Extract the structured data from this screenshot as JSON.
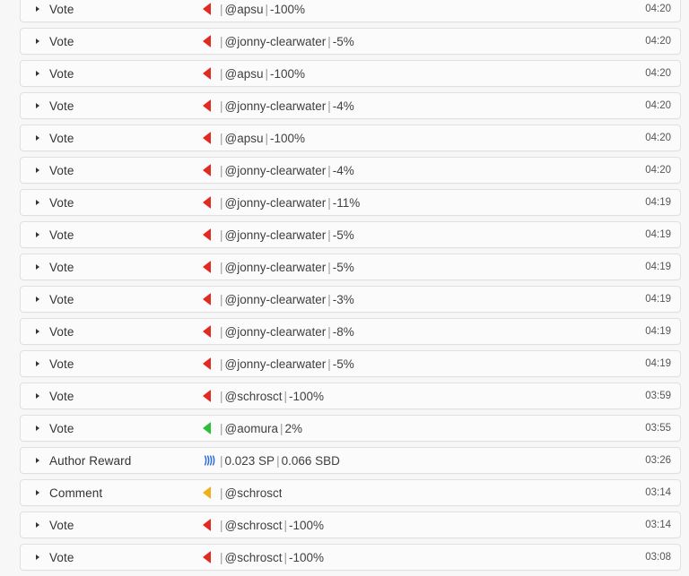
{
  "icons": {
    "expander": "chevron-right-icon",
    "downvote": "downvote-triangle-icon",
    "upvote": "upvote-triangle-icon",
    "comment": "comment-triangle-icon",
    "steem": "steem-logo-icon"
  },
  "colors": {
    "page_background": "#f7f7f7",
    "row_background": "#fbfbfb",
    "row_border": "#e0e0e0",
    "downvote_red": "#e02a22",
    "upvote_green": "#2cc039",
    "comment_yellow": "#efb01c",
    "steem_blue": "#2d6cdf",
    "label_text": "#333333",
    "detail_text": "#3f3f3f",
    "time_text": "#555555",
    "separator": "#9a9a9a"
  },
  "separator": "|",
  "rows": [
    {
      "op": "Vote",
      "icon": "downvote",
      "account": "@apsu",
      "value": "-100%",
      "time": "04:20"
    },
    {
      "op": "Vote",
      "icon": "downvote",
      "account": "@jonny-clearwater",
      "value": "-5%",
      "time": "04:20"
    },
    {
      "op": "Vote",
      "icon": "downvote",
      "account": "@apsu",
      "value": "-100%",
      "time": "04:20"
    },
    {
      "op": "Vote",
      "icon": "downvote",
      "account": "@jonny-clearwater",
      "value": "-4%",
      "time": "04:20"
    },
    {
      "op": "Vote",
      "icon": "downvote",
      "account": "@apsu",
      "value": "-100%",
      "time": "04:20"
    },
    {
      "op": "Vote",
      "icon": "downvote",
      "account": "@jonny-clearwater",
      "value": "-4%",
      "time": "04:20"
    },
    {
      "op": "Vote",
      "icon": "downvote",
      "account": "@jonny-clearwater",
      "value": "-11%",
      "time": "04:19"
    },
    {
      "op": "Vote",
      "icon": "downvote",
      "account": "@jonny-clearwater",
      "value": "-5%",
      "time": "04:19"
    },
    {
      "op": "Vote",
      "icon": "downvote",
      "account": "@jonny-clearwater",
      "value": "-5%",
      "time": "04:19"
    },
    {
      "op": "Vote",
      "icon": "downvote",
      "account": "@jonny-clearwater",
      "value": "-3%",
      "time": "04:19"
    },
    {
      "op": "Vote",
      "icon": "downvote",
      "account": "@jonny-clearwater",
      "value": "-8%",
      "time": "04:19"
    },
    {
      "op": "Vote",
      "icon": "downvote",
      "account": "@jonny-clearwater",
      "value": "-5%",
      "time": "04:19"
    },
    {
      "op": "Vote",
      "icon": "downvote",
      "account": "@schrosct",
      "value": "-100%",
      "time": "03:59"
    },
    {
      "op": "Vote",
      "icon": "upvote",
      "account": "@aomura",
      "value": "2%",
      "time": "03:55"
    },
    {
      "op": "Author Reward",
      "icon": "steem",
      "account": "0.023 SP",
      "value": "0.066 SBD",
      "time": "03:26"
    },
    {
      "op": "Comment",
      "icon": "comment",
      "account": "@schrosct",
      "value": "",
      "time": "03:14"
    },
    {
      "op": "Vote",
      "icon": "downvote",
      "account": "@schrosct",
      "value": "-100%",
      "time": "03:14"
    },
    {
      "op": "Vote",
      "icon": "downvote",
      "account": "@schrosct",
      "value": "-100%",
      "time": "03:08"
    }
  ]
}
